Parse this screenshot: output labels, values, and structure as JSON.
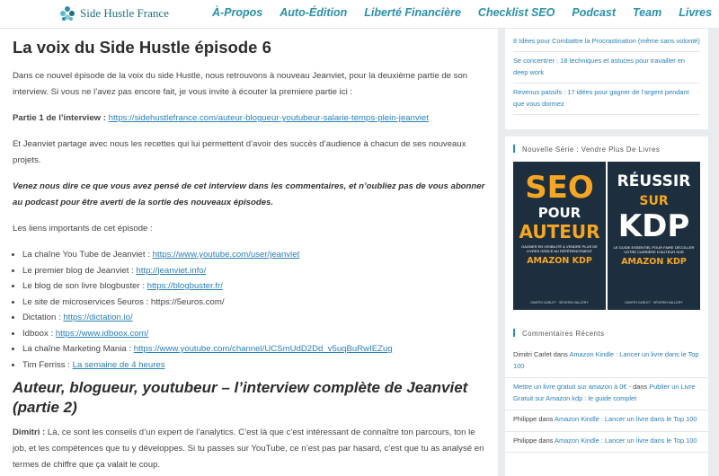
{
  "header": {
    "logo_text": "Side Hustle France",
    "nav": [
      "À-Propos",
      "Auto-Édition",
      "Liberté Financière",
      "Checklist SEO",
      "Podcast",
      "Team",
      "Livres"
    ]
  },
  "article": {
    "title": "La voix du Side Hustle épisode 6",
    "intro": "Dans ce nouvel épisode de la voix du side Hustle, nous retrouvons à nouveau Jeanviet, pour la deuxième partie de son interview. Si vous ne l’avez pas encore fait, je vous invite à écouter la premiere partie ici :",
    "part1_label": "Partie 1 de l’interview :",
    "part1_link": "https://sidehustlefrance.com/auteur-blogueur-youtubeur-salarie-temps-plein-jeanviet",
    "recipes": "Et Jeanviet partage avec nous les recettes qui lui permettent d’avoir des succès d’audience à chacun de ses nouveaux projets.",
    "cta": "Venez nous dire ce que vous avez pensé de cet interview dans les commentaires, et n’oubliez pas de vous abonner au podcast pour être averti de la sortie des nouveaux épisodes.",
    "links_heading": "Les liens importants de cet épisode :",
    "links": [
      {
        "label": "La chaîne You Tube de Jeanviet :",
        "link": "https://www.youtube.com/user/jeanviet"
      },
      {
        "label": "Le premier blog de Jeanviet :",
        "link": "http://jeanviet.info/"
      },
      {
        "label": "Le blog de son livre blogbuster :",
        "link": "https://blogbuster.fr/"
      },
      {
        "label": "Le site de microservices 5euros : https://5euros.com/",
        "link": ""
      },
      {
        "label": "Dictation :",
        "link": "https://dictation.io/"
      },
      {
        "label": "Idboox :",
        "link": "https://www.idboox.com/"
      },
      {
        "label": "La chaîne Marketing Mania :",
        "link": "https://www.youtube.com/channel/UCSmUdD2Dd_v5uqBuRwIEZug"
      },
      {
        "label": "Tim Ferriss :",
        "link": "La semaine de 4 heures"
      }
    ],
    "subtitle": "Auteur, blogueur, youtubeur – l’interview complète de Jeanviet (partie 2)",
    "dimitri_label": "Dimitri :",
    "dimitri_text": "Là, ce sont les conseils d’un expert de l’analytics. C’est là que c’est intéressant de connaître ton parcours, ton le job, et les compétences que tu y développes. Si tu passes sur YouTube, ce n’est pas par hasard, c’est que tu as analysé en termes de chiffre que ça valait le coup."
  },
  "sidebar": {
    "recent_posts": [
      "8 Idées pour Combattre la Procrastination (même sans volonté)",
      "Se concentrer : 18 techniques et astuces pour travailler en deep work",
      "Revenus passifs : 17 idées pour gagner de l’argent pendant que vous dormez"
    ],
    "series_title": "Nouvelle Série : Vendre Plus De Livres",
    "book1": {
      "l1": "SEO",
      "l2": "POUR",
      "l3": "AUTEUR",
      "blurb": "GAGNER EN VISIBILITÉ & VENDRE PLUS DE LIVRES GRÂCE AU RÉFÉRENCEMENT",
      "kdp": "AMAZON KDP",
      "authors": "DIMITRI CARLET · SÉVERIN VALLÉRY"
    },
    "book2": {
      "l1": "RÉUSSIR",
      "l2": "SUR",
      "l3": "KDP",
      "blurb": "LE GUIDE ESSENTIEL POUR FAIRE DÉCOLLER VOTRE CARRIÈRE D’AUTEUR SUR",
      "kdp": "AMAZON KDP",
      "authors": "DIMITRI CARLET · SÉVERIN VALLÉRY"
    },
    "comments_title": "Commentaires Récents",
    "comments": [
      {
        "author": "Dimitri Carlet",
        "sep": " dans ",
        "post": "Amazon Kindle : Lancer un livre dans le Top 100"
      },
      {
        "author": "Mettre un livre gratuit sur amazon à 0€ -",
        "sep": " dans ",
        "post": "Publier un Livre Gratuit sur Amazon kdp : le guide complet"
      },
      {
        "author": "Philippe",
        "sep": " dans ",
        "post": "Amazon Kindle : Lancer un livre dans le Top 100"
      },
      {
        "author": "Philippe",
        "sep": " dans ",
        "post": "Amazon Kindle : Lancer un livre dans le Top 100"
      }
    ]
  },
  "colors": {
    "accent": "#2a8fa8",
    "link": "#2a7fb8",
    "book_bg": "#1d2f3f",
    "book_orange": "#f5a623"
  },
  "icons": {
    "logo": "leaf-cluster-icon"
  }
}
